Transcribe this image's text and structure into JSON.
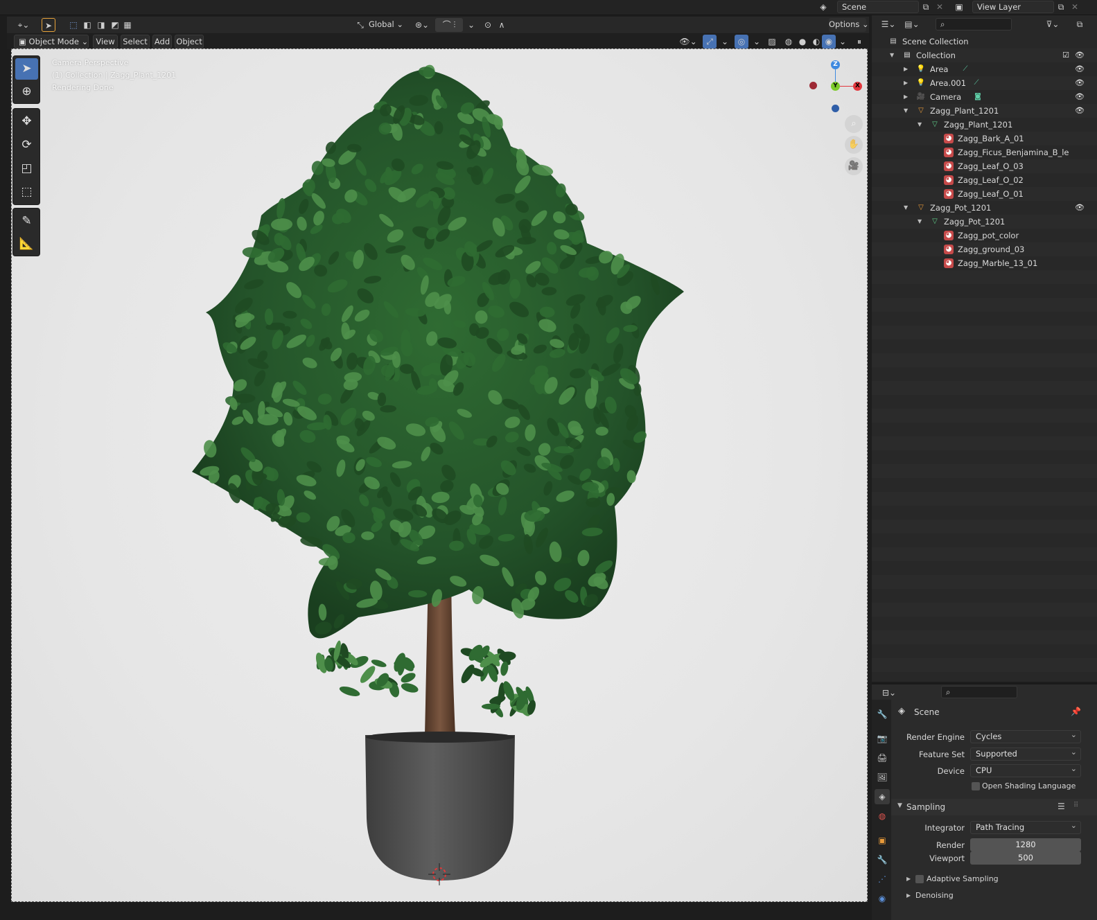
{
  "topbar": {
    "scene_name": "Scene",
    "view_layer": "View Layer"
  },
  "viewport_header": {
    "transform_orientation": "Global",
    "options_label": "Options",
    "mode_label": "Object Mode",
    "menus": [
      "View",
      "Select",
      "Add",
      "Object"
    ]
  },
  "viewport": {
    "overlay_lines": [
      "Camera Perspective",
      "(1) Collection | Zagg_Plant_1201",
      "Rendering Done"
    ],
    "gizmo_axes": {
      "z": "Z",
      "y": "Y",
      "x": "X"
    }
  },
  "outliner": {
    "rows": [
      {
        "label": "Scene Collection",
        "type": "scene-collection"
      },
      {
        "label": "Collection",
        "type": "collection"
      },
      {
        "label": "Area",
        "type": "light"
      },
      {
        "label": "Area.001",
        "type": "light"
      },
      {
        "label": "Camera",
        "type": "camera"
      },
      {
        "label": "Zagg_Plant_1201",
        "type": "object"
      },
      {
        "label": "Zagg_Plant_1201",
        "type": "mesh"
      },
      {
        "label": "Zagg_Bark_A_01",
        "type": "material"
      },
      {
        "label": "Zagg_Ficus_Benjamina_B_le",
        "type": "material"
      },
      {
        "label": "Zagg_Leaf_O_03",
        "type": "material"
      },
      {
        "label": "Zagg_Leaf_O_02",
        "type": "material"
      },
      {
        "label": "Zagg_Leaf_O_01",
        "type": "material"
      },
      {
        "label": "Zagg_Pot_1201",
        "type": "object"
      },
      {
        "label": "Zagg_Pot_1201",
        "type": "mesh"
      },
      {
        "label": "Zagg_pot_color",
        "type": "material"
      },
      {
        "label": "Zagg_ground_03",
        "type": "material"
      },
      {
        "label": "Zagg_Marble_13_01",
        "type": "material"
      }
    ]
  },
  "properties": {
    "context_title": "Scene",
    "render_engine_label": "Render Engine",
    "render_engine_value": "Cycles",
    "feature_set_label": "Feature Set",
    "feature_set_value": "Supported",
    "device_label": "Device",
    "device_value": "CPU",
    "osl_label": "Open Shading Language",
    "sampling_label": "Sampling",
    "integrator_label": "Integrator",
    "integrator_value": "Path Tracing",
    "render_label": "Render",
    "render_value": "1280",
    "viewport_label": "Viewport",
    "viewport_value": "500",
    "adaptive_label": "Adaptive Sampling",
    "denoising_label": "Denoising"
  },
  "colors": {
    "accent": "#4772b3",
    "leaf_dark": "#1f4a22",
    "leaf_mid": "#2f6b32",
    "leaf_light": "#4e8f4a",
    "trunk": "#6b4a36",
    "pot": "#555555"
  }
}
